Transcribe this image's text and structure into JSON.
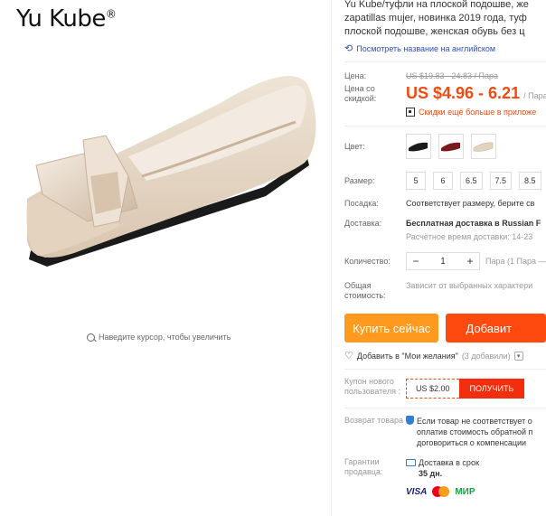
{
  "brand": {
    "name": "Yu Kube",
    "mark": "®"
  },
  "gallery": {
    "zoom_hint": "Наведите курсор, чтобы увеличить"
  },
  "product": {
    "title_lines": [
      "Yu Kube/туфли на плоской подошве, же",
      "zapatillas mujer, новинка 2019 года, туф",
      "плоской подошве, женская обувь без ц"
    ],
    "translate_link": "Посмотреть название на английском"
  },
  "price": {
    "label": "Цена:",
    "old": "US $19.83 - 24.83 / Пара",
    "sale_label": "Цена со скидкой:",
    "sale": "US $4.96 - 6.21",
    "sale_unit": "/ Пара",
    "app_discount": "Скидки ещё больше в приложе"
  },
  "options": {
    "color_label": "Цвет:",
    "colors": [
      "черный",
      "бордовый",
      "бежевый"
    ],
    "size_label": "Размер:",
    "sizes": [
      "5",
      "6",
      "6.5",
      "7.5",
      "8.5"
    ],
    "fit_label": "Посадка:",
    "fit_value": "Соответствует размеру, берите св",
    "shipping_label": "Доставка:",
    "shipping_value": "Бесплатная доставка в Russian F",
    "shipping_eta": "Расчётное время доставки: 14-23",
    "qty_label": "Количество:",
    "qty_value": "1",
    "qty_minus": "−",
    "qty_plus": "+",
    "qty_note": "Пара (1 Пара —",
    "total_label": "Общая стоимость:",
    "total_value": "Зависит от выбранных характери"
  },
  "actions": {
    "buy": "Купить сейчас",
    "cart": "Добавит"
  },
  "wishlist": {
    "label": "Добавить в \"Мои желания\"",
    "count": "(3 добавили)"
  },
  "coupon": {
    "label": "Купон нового пользователя :",
    "amount": "US $2.00",
    "get": "ПОЛУЧИТЬ"
  },
  "returns": {
    "label": "Возврат товара",
    "lines": [
      "Если товар не соответствует о",
      "оплатив стоимость обратной п",
      "договориться о компенсации"
    ]
  },
  "guarantee": {
    "label": "Гарантии продавца:",
    "line1": "Доставка в срок",
    "line2": "35 дн."
  },
  "payment": {
    "visa": "VISA",
    "mir": "МИР"
  },
  "colors": {
    "accent": "#f24a11",
    "buy": "#ff9a1f",
    "cart": "#ff4a0f",
    "link": "#2e4fb8",
    "shoe": "#e6d8c6"
  }
}
